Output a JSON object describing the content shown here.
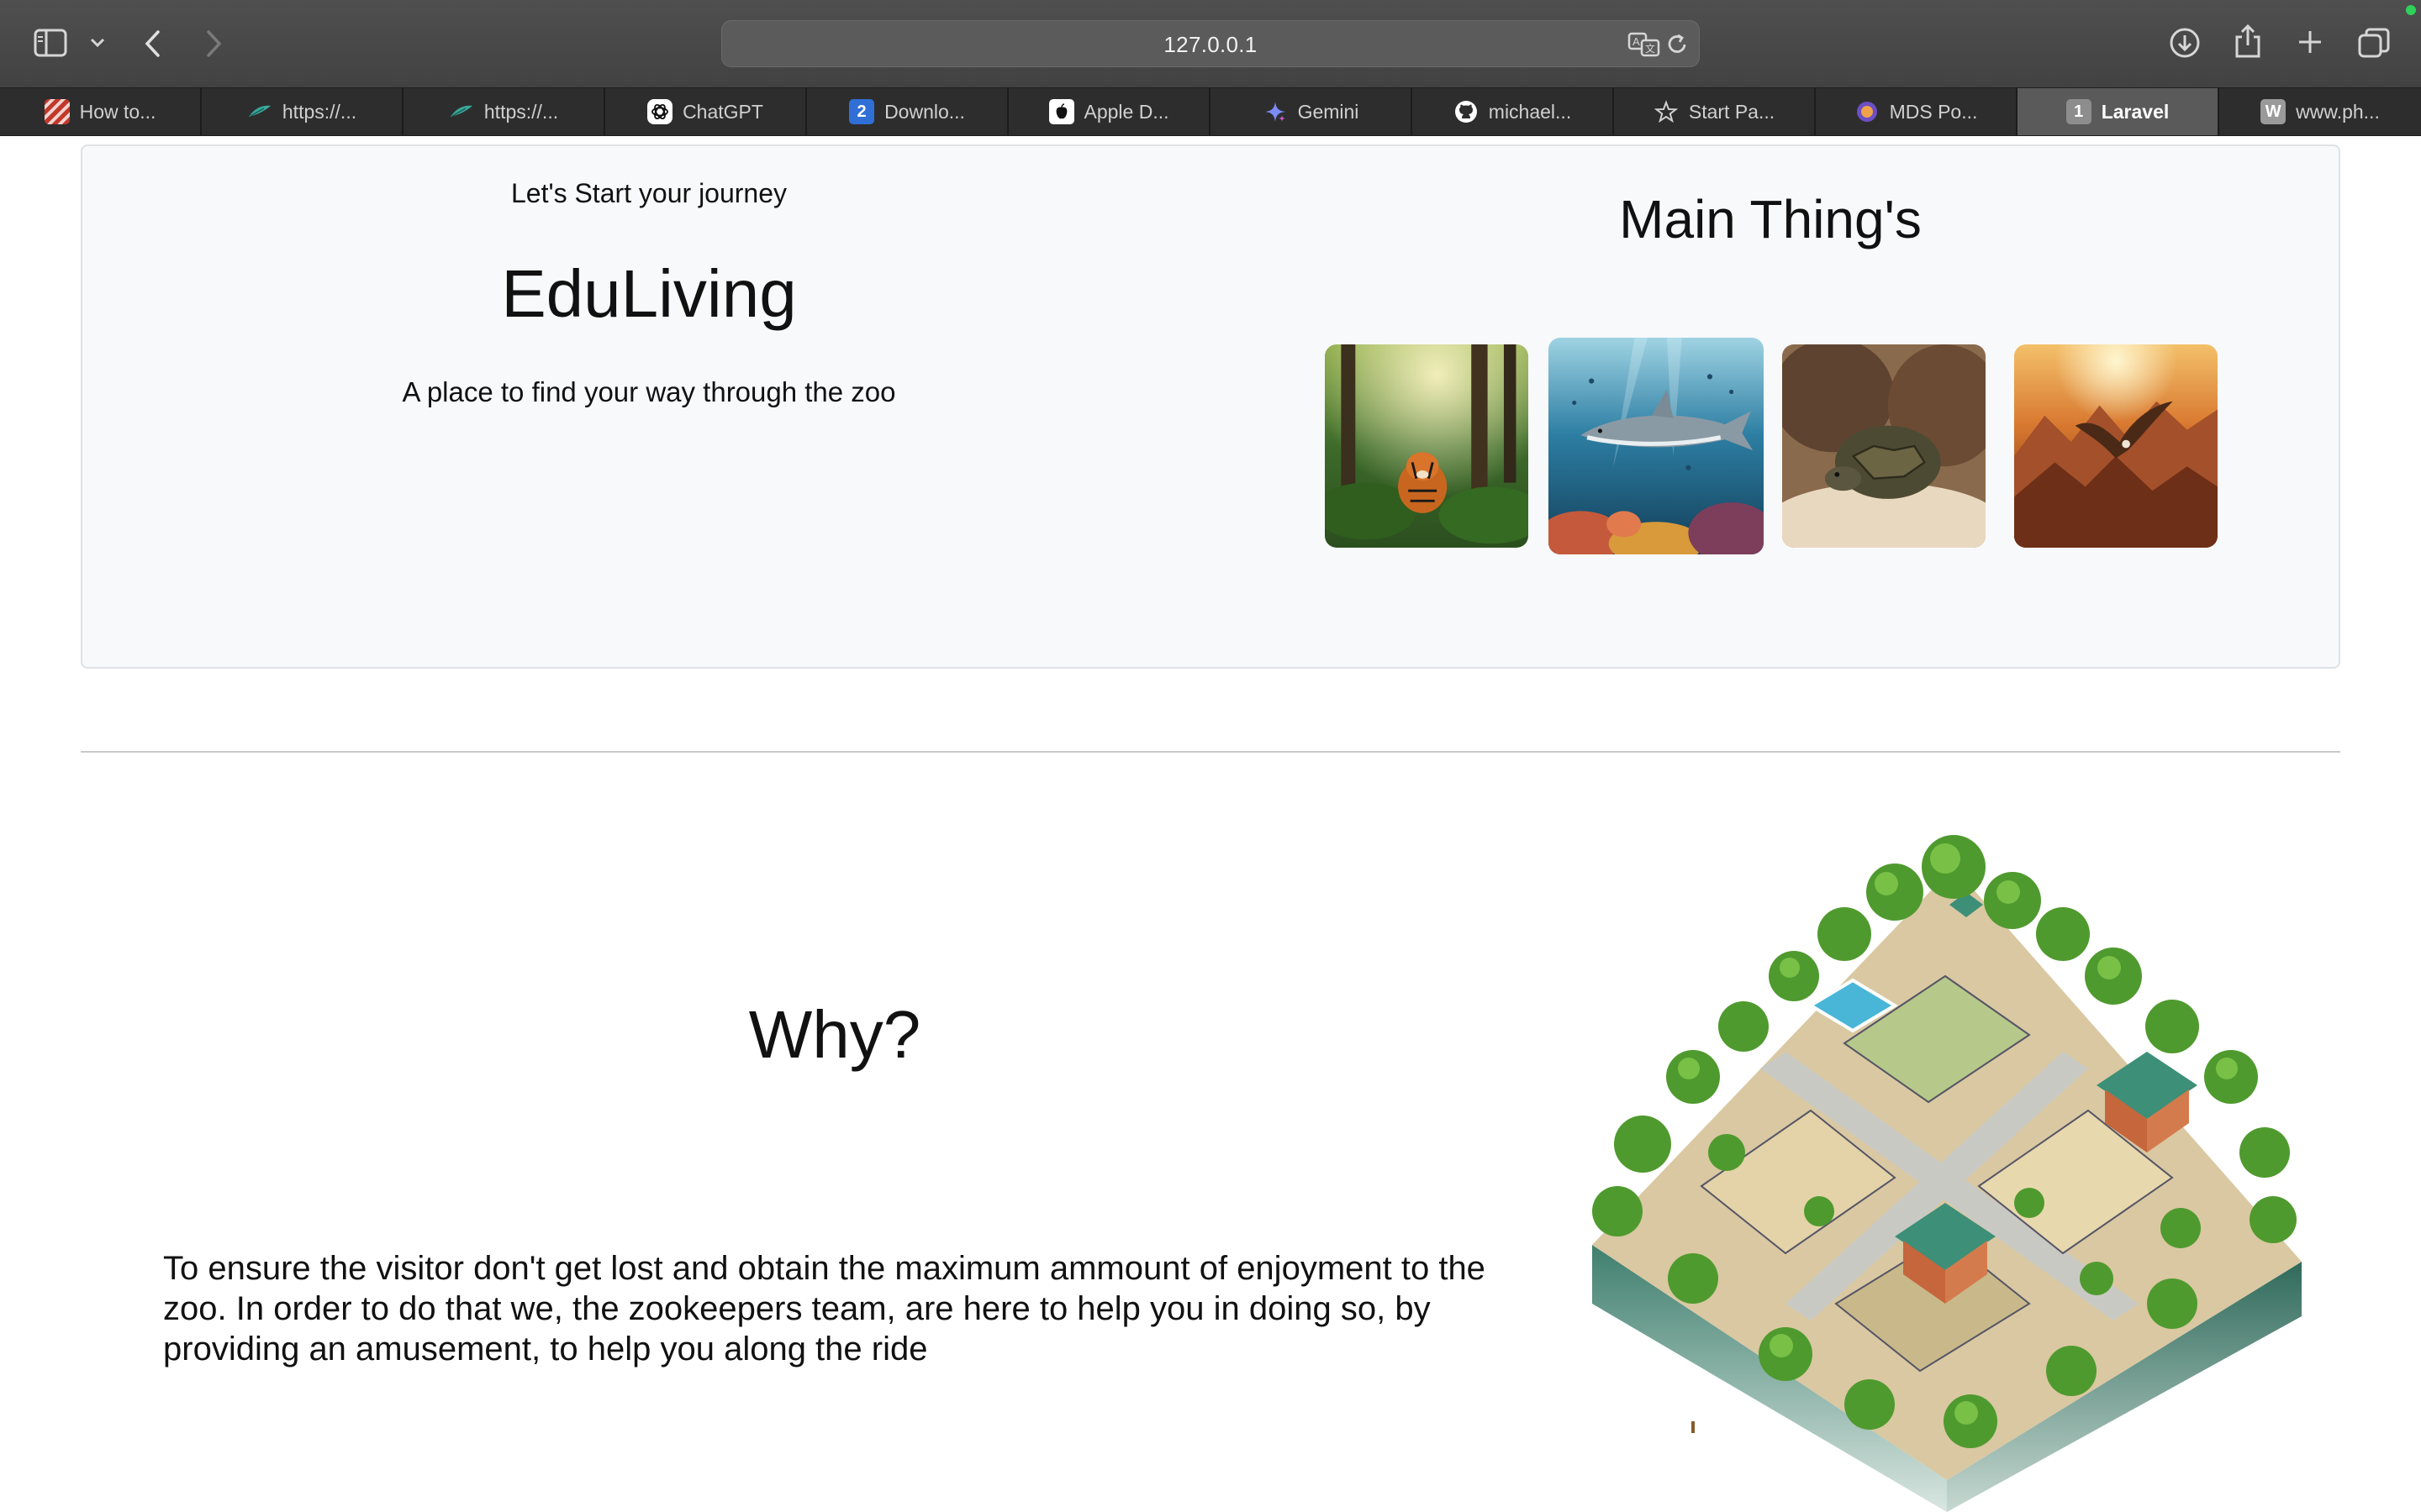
{
  "browser": {
    "url": "127.0.0.1",
    "tabs": [
      {
        "label": "How to...",
        "icon": "striped-logo-icon",
        "active": false
      },
      {
        "label": "https://...",
        "icon": "laravel-feather-icon",
        "active": false
      },
      {
        "label": "https://...",
        "icon": "laravel-feather-icon",
        "active": false
      },
      {
        "label": "ChatGPT",
        "icon": "chatgpt-icon",
        "active": false
      },
      {
        "label": "Downlo...",
        "icon": "number-2-icon",
        "favicon_text": "2",
        "active": false
      },
      {
        "label": "Apple D...",
        "icon": "apple-developer-icon",
        "active": false
      },
      {
        "label": "Gemini",
        "icon": "gemini-sparkle-icon",
        "active": false
      },
      {
        "label": "michael...",
        "icon": "github-icon",
        "active": false
      },
      {
        "label": "Start Pa...",
        "icon": "star-icon",
        "active": false
      },
      {
        "label": "MDS Po...",
        "icon": "mds-logo-icon",
        "active": false
      },
      {
        "label": "Laravel",
        "icon": "number-1-icon",
        "favicon_text": "1",
        "active": true
      },
      {
        "label": "www.ph...",
        "icon": "w-letter-icon",
        "favicon_text": "W",
        "active": false
      }
    ]
  },
  "hero": {
    "intro": "Let's Start your journey",
    "brand": "EduLiving",
    "tagline": "A place to find your way through the zoo",
    "gallery_title": "Main Thing's",
    "gallery": [
      "tiger-in-forest-image",
      "shark-underwater-image",
      "tortoise-in-sand-image",
      "eagle-over-canyon-image"
    ]
  },
  "why": {
    "title": "Why?",
    "body": "To ensure the visitor don't get lost and obtain the maximum ammount of enjoyment to the zoo. In order to do that we, the zookeepers team, are here to help you in doing so, by providing an amusement, to help you along the ride",
    "illustration": "isometric-zoo-map-image"
  },
  "colors": {
    "toolbar": "#474747",
    "tabbar": "#2d2d2d",
    "active_tab": "#5a5a5a",
    "hero_card": "#f8f9fa",
    "hero_border": "#dee2e6",
    "text": "#111111",
    "green_indicator": "#2fd158"
  }
}
